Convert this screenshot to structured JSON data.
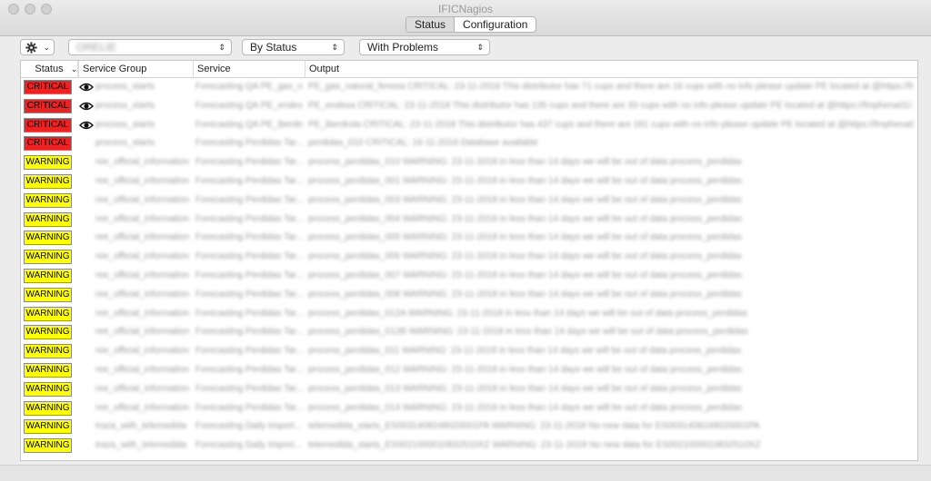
{
  "window": {
    "title": "IFICNagios"
  },
  "tabs": [
    {
      "label": "Status",
      "active": true
    },
    {
      "label": "Configuration",
      "active": false
    }
  ],
  "toolbar": {
    "gear_icon": "gear-icon",
    "group_select_value": "ORELIE",
    "status_select_value": "By Status",
    "problems_select_value": "With Problems"
  },
  "table": {
    "columns": [
      "Status",
      "Service Group",
      "Service",
      "Output"
    ],
    "rows": [
      {
        "status": "CRITICAL",
        "eye": true,
        "group": "process_starts",
        "service": "Forecasting QA PE_gas_natural",
        "output": "PE_gas_natural_fenosa CRITICAL: 23-11-2018 This distributor has 71 cups and there are 16 cups with no info please update PE located at @https://fmphena01/..."
      },
      {
        "status": "CRITICAL",
        "eye": true,
        "group": "process_starts",
        "service": "Forecasting QA PE_endesa",
        "output": "PE_endesa CRITICAL: 23-11-2018 This distributor has 135 cups and there are 33 cups with no info please update PE located at @https://fmphena01/..."
      },
      {
        "status": "CRITICAL",
        "eye": true,
        "group": "process_starts",
        "service": "Forecasting QA PE_iberdrola",
        "output": "PE_iberdrola CRITICAL: 23-11-2018 This distributor has 437 cups and there are 181 cups with no info please update PE located at @https://fmphena01/..."
      },
      {
        "status": "CRITICAL",
        "eye": false,
        "group": "process_starts",
        "service": "Forecasting Perdidas Tar...",
        "output": "perdidas_010 CRITICAL: 16-11-2018 Database available"
      },
      {
        "status": "WARNING",
        "eye": false,
        "group": "ree_official_information",
        "service": "Forecasting Perdidas Tar...",
        "output": "process_perdidas_010 WARNING: 23-11-2018 in less than 14 days we will be out of data process_perdidas"
      },
      {
        "status": "WARNING",
        "eye": false,
        "group": "ree_official_information",
        "service": "Forecasting Perdidas Tar...",
        "output": "process_perdidas_001 WARNING: 23-11-2018 in less than 14 days we will be out of data process_perdidas"
      },
      {
        "status": "WARNING",
        "eye": false,
        "group": "ree_official_information",
        "service": "Forecasting Perdidas Tar...",
        "output": "process_perdidas_003 WARNING: 23-11-2018 in less than 14 days we will be out of data process_perdidas"
      },
      {
        "status": "WARNING",
        "eye": false,
        "group": "ree_official_information",
        "service": "Forecasting Perdidas Tar...",
        "output": "process_perdidas_004 WARNING: 23-11-2018 in less than 14 days we will be out of data process_perdidas"
      },
      {
        "status": "WARNING",
        "eye": false,
        "group": "ree_official_information",
        "service": "Forecasting Perdidas Tar...",
        "output": "process_perdidas_005 WARNING: 23-11-2018 in less than 14 days we will be out of data process_perdidas"
      },
      {
        "status": "WARNING",
        "eye": false,
        "group": "ree_official_information",
        "service": "Forecasting Perdidas Tar...",
        "output": "process_perdidas_006 WARNING: 23-11-2018 in less than 14 days we will be out of data process_perdidas"
      },
      {
        "status": "WARNING",
        "eye": false,
        "group": "ree_official_information",
        "service": "Forecasting Perdidas Tar...",
        "output": "process_perdidas_007 WARNING: 23-11-2018 in less than 14 days we will be out of data process_perdidas"
      },
      {
        "status": "WARNING",
        "eye": false,
        "group": "ree_official_information",
        "service": "Forecasting Perdidas Tar...",
        "output": "process_perdidas_008 WARNING: 23-11-2018 in less than 14 days we will be out of data process_perdidas"
      },
      {
        "status": "WARNING",
        "eye": false,
        "group": "ree_official_information",
        "service": "Forecasting Perdidas Tar...",
        "output": "process_perdidas_012A WARNING: 23-11-2018 in less than 14 days we will be out of data process_perdidas"
      },
      {
        "status": "WARNING",
        "eye": false,
        "group": "ree_official_information",
        "service": "Forecasting Perdidas Tar...",
        "output": "process_perdidas_012B WARNING: 23-11-2018 in less than 14 days we will be out of data process_perdidas"
      },
      {
        "status": "WARNING",
        "eye": false,
        "group": "ree_official_information",
        "service": "Forecasting Perdidas Tar...",
        "output": "process_perdidas_011 WARNING: 23-11-2018 in less than 14 days we will be out of data process_perdidas"
      },
      {
        "status": "WARNING",
        "eye": false,
        "group": "ree_official_information",
        "service": "Forecasting Perdidas Tar...",
        "output": "process_perdidas_012 WARNING: 23-11-2018 in less than 14 days we will be out of data process_perdidas"
      },
      {
        "status": "WARNING",
        "eye": false,
        "group": "ree_official_information",
        "service": "Forecasting Perdidas Tar...",
        "output": "process_perdidas_013 WARNING: 23-11-2018 in less than 14 days we will be out of data process_perdidas"
      },
      {
        "status": "WARNING",
        "eye": false,
        "group": "ree_official_information",
        "service": "Forecasting Perdidas Tar...",
        "output": "process_perdidas_014 WARNING: 23-11-2018 in less than 14 days we will be out of data process_perdidas"
      },
      {
        "status": "WARNING",
        "eye": false,
        "group": "traza_with_telemedida",
        "service": "Forecasting Daily Import...",
        "output": "telemedida_starts_ES0031408248020001PA WARNING: 23-11-2018 No new data for ES0031408248020001PA"
      },
      {
        "status": "WARNING",
        "eye": false,
        "group": "traza_with_telemedida",
        "service": "Forecasting Daily Import...",
        "output": "telemedida_starts_ES0021000010832510XZ WARNING: 23-11-2018 No new data for ES0021000010832510XZ"
      }
    ]
  },
  "colors": {
    "critical": "#ee2222",
    "warning": "#ffff00"
  }
}
